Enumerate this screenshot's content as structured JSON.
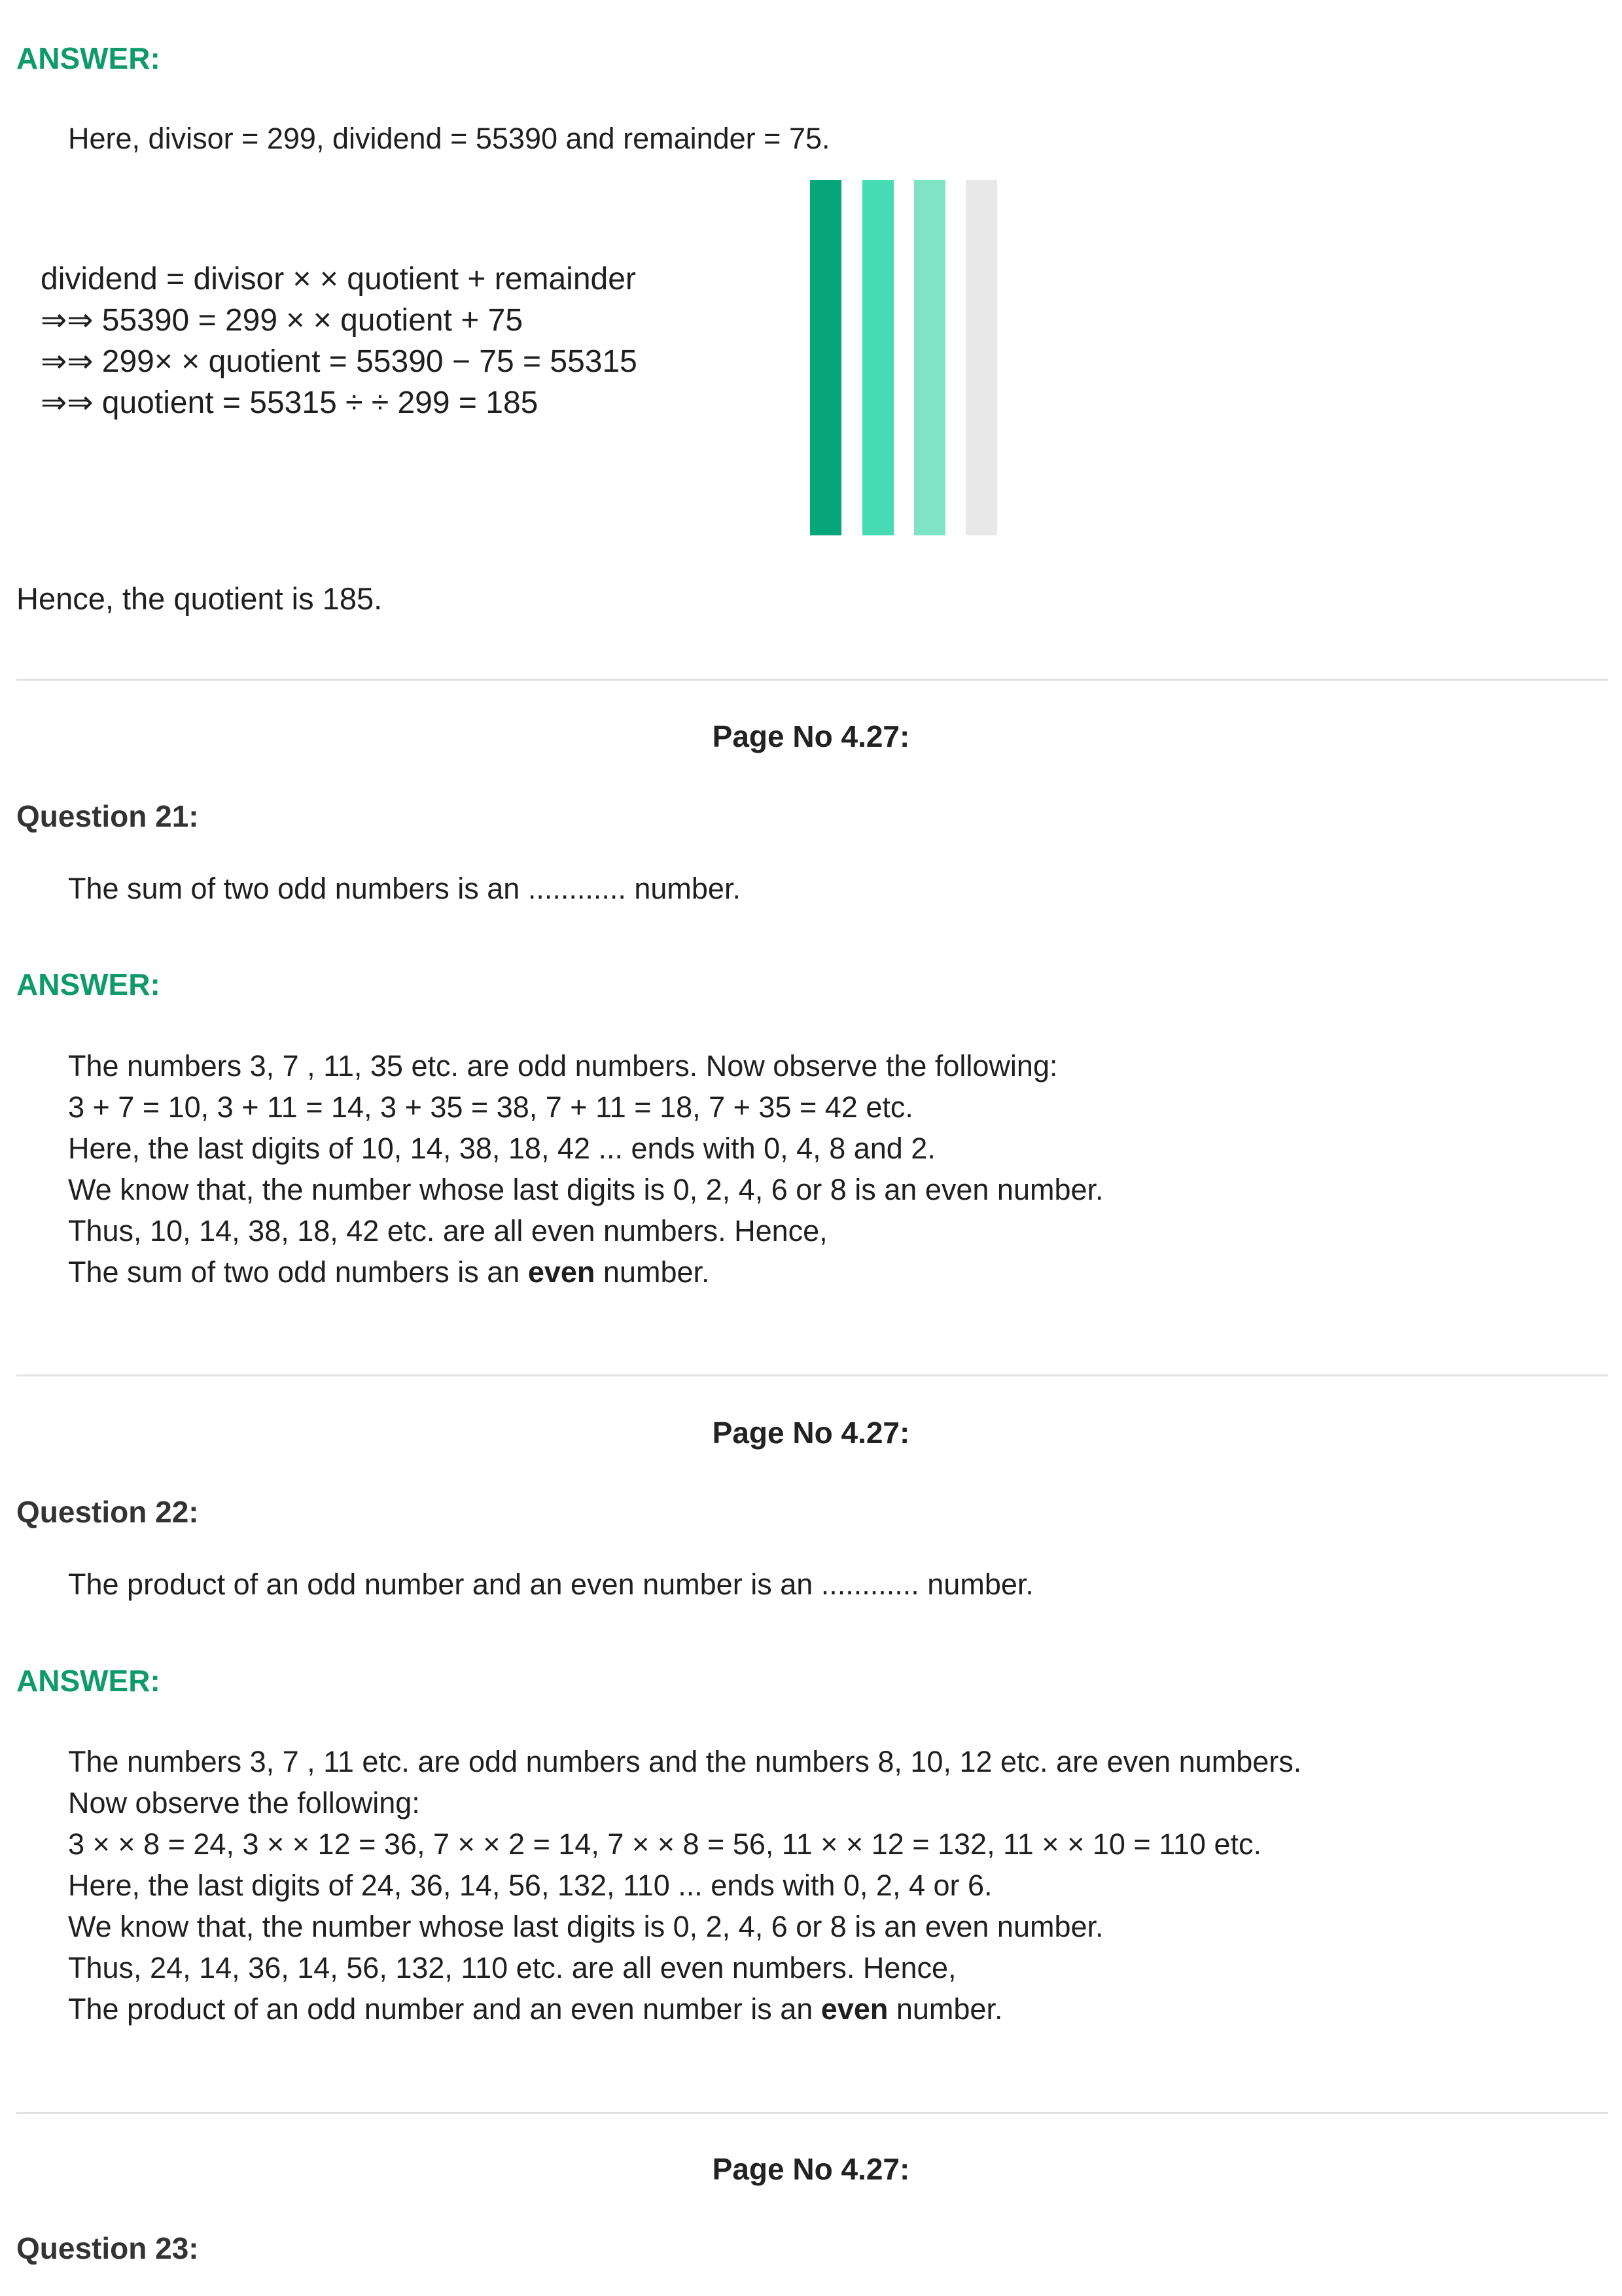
{
  "colors": {
    "accent": "#0f9a6c",
    "bar1": "#07a57a",
    "bar2": "#46dbb2",
    "bar3": "#7fe3c4",
    "bar4": "#e8e8e8",
    "divider": "#e2e2e2"
  },
  "answer1": {
    "heading": "ANSWER:",
    "given": "Here, divisor = 299, dividend = 55390 and remainder = 75.",
    "steps": [
      "dividend = divisor × × quotient + remainder",
      "⇒⇒  55390 = 299 × × quotient + 75",
      "⇒⇒  299× × quotient = 55390 − 75 = 55315",
      "⇒⇒ quotient = 55315 ÷ ÷ 299 =  185"
    ],
    "conclusion": "Hence, the quotient is 185."
  },
  "q21": {
    "page_label": "Page No 4.27:",
    "title": "Question 21:",
    "text": "The sum of two odd numbers is an ............ number.",
    "answer_heading": "ANSWER:",
    "lines": [
      "The numbers 3, 7 , 11, 35 etc. are odd numbers. Now observe the following:",
      "3 + 7 = 10, 3 + 11 = 14, 3 + 35 = 38, 7 + 11 = 18, 7 + 35 = 42 etc.",
      "Here, the last digits of 10, 14, 38, 18, 42 ... ends with 0, 4, 8 and 2.",
      "We know that, the number whose last digits is 0, 2, 4, 6 or 8 is an even number.",
      "Thus, 10, 14, 38, 18, 42 etc. are all even numbers. Hence,"
    ],
    "final_before": "The sum of two odd numbers is an ",
    "final_bold": "even",
    "final_after": " number."
  },
  "q22": {
    "page_label": "Page No 4.27:",
    "title": "Question 22:",
    "text": "The product of an odd number and an even number is an ............ number.",
    "answer_heading": "ANSWER:",
    "lines": [
      "The numbers 3, 7 , 11 etc. are odd numbers and the numbers 8, 10, 12 etc. are even numbers.",
      "Now observe the following:",
      "3 × × 8 = 24, 3 × × 12 = 36, 7 × × 2 = 14, 7 × × 8 = 56, 11 × × 12 = 132, 11 × × 10 = 110 etc.",
      "Here, the last digits of 24, 36, 14, 56, 132, 110 ... ends with 0, 2, 4 or 6.",
      "We know that, the number whose last digits is 0, 2, 4, 6 or 8 is an even number.",
      "Thus, 24, 14, 36, 14, 56, 132, 110 etc. are all even numbers. Hence,"
    ],
    "final_before": "The product of an odd number and an even number is an ",
    "final_bold": "even",
    "final_after": " number."
  },
  "q23": {
    "page_label": "Page No 4.27:",
    "title": "Question 23:"
  }
}
